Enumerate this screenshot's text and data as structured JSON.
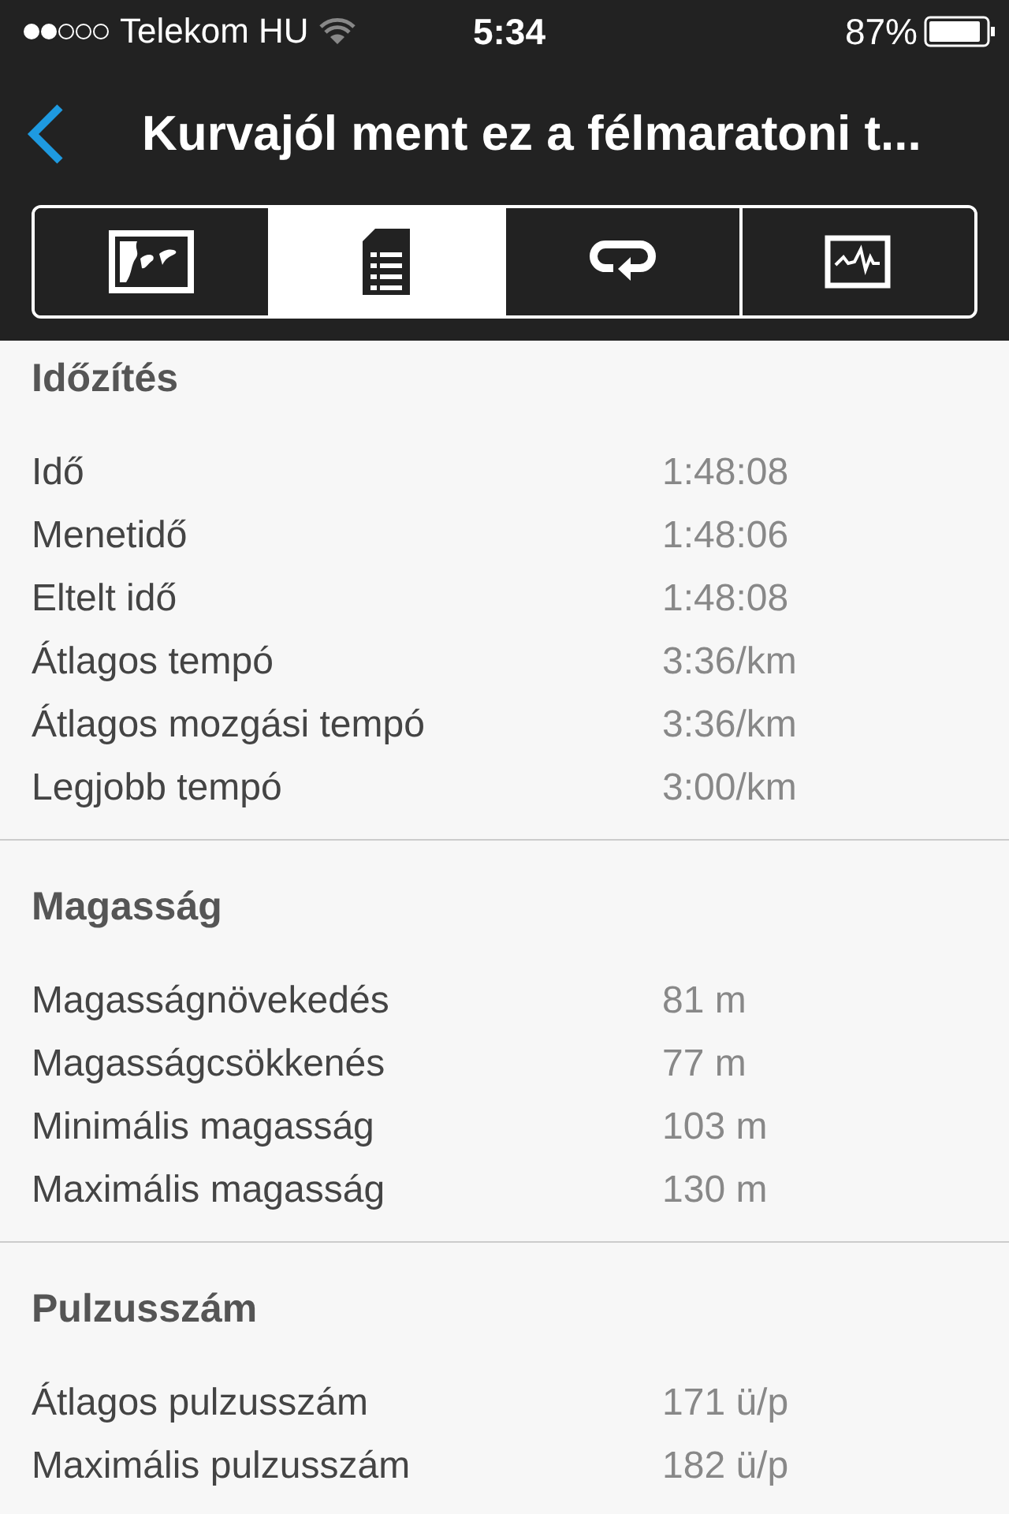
{
  "status_bar": {
    "carrier": "Telekom HU",
    "time": "5:34",
    "battery": "87%"
  },
  "nav": {
    "title": "Kurvajól ment ez a félmaratoni t..."
  },
  "tabs": [
    {
      "kind": "map",
      "selected": false
    },
    {
      "kind": "list",
      "selected": true
    },
    {
      "kind": "laps",
      "selected": false
    },
    {
      "kind": "graph",
      "selected": false
    }
  ],
  "sections": [
    {
      "title": "Időzítés",
      "rows": [
        {
          "label": "Idő",
          "value": "1:48:08"
        },
        {
          "label": "Menetidő",
          "value": "1:48:06"
        },
        {
          "label": "Eltelt idő",
          "value": "1:48:08"
        },
        {
          "label": "Átlagos tempó",
          "value": "3:36/km"
        },
        {
          "label": "Átlagos mozgási tempó",
          "value": "3:36/km"
        },
        {
          "label": "Legjobb tempó",
          "value": "3:00/km"
        }
      ]
    },
    {
      "title": "Magasság",
      "rows": [
        {
          "label": "Magasságnövekedés",
          "value": "81 m"
        },
        {
          "label": "Magasságcsökkenés",
          "value": "77 m"
        },
        {
          "label": "Minimális magasság",
          "value": "103 m"
        },
        {
          "label": "Maximális magasság",
          "value": "130 m"
        }
      ]
    },
    {
      "title": "Pulzusszám",
      "rows": [
        {
          "label": "Átlagos pulzusszám",
          "value": "171 ü/p"
        },
        {
          "label": "Maximális pulzusszám",
          "value": "182 ü/p"
        }
      ]
    }
  ]
}
